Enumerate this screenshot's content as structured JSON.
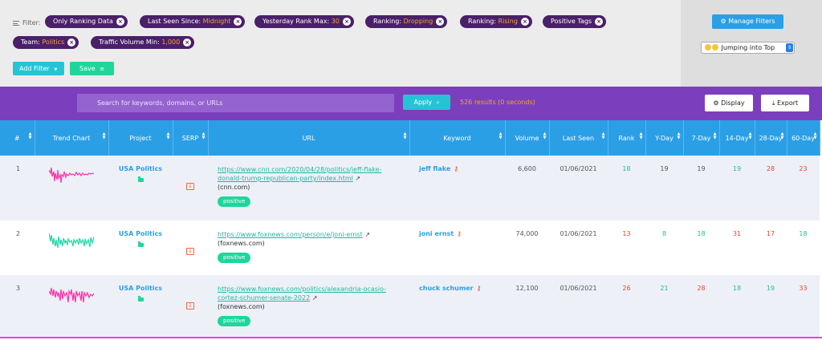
{
  "filters": {
    "label": "Filter:",
    "chips": [
      {
        "key": "Only Ranking Data",
        "value": ""
      },
      {
        "key": "Last Seen Since: ",
        "value": "Midnight"
      },
      {
        "key": "Yesterday Rank Max: ",
        "value": "30"
      },
      {
        "key": "Ranking: ",
        "value": "Dropping"
      },
      {
        "key": "Ranking: ",
        "value": "Rising"
      },
      {
        "key": "Positive Tags",
        "value": ""
      },
      {
        "key": "Team: ",
        "value": "Politics"
      },
      {
        "key": "Traffic Volume Min: ",
        "value": "1,000"
      }
    ],
    "add_filter_label": "Add Filter",
    "save_label": "Save",
    "manage_filters_label": "Manage Filters",
    "preset_selected": "Jumping into Top"
  },
  "search": {
    "placeholder": "Search for keywords, domains, or URLs",
    "apply_label": "Apply",
    "results_text": "526 results (0 seconds)",
    "display_label": "Display",
    "export_label": "Export"
  },
  "table": {
    "columns": [
      "#",
      "Trend Chart",
      "Project",
      "SERP",
      "URL",
      "Keyword",
      "Volume",
      "Last Seen",
      "Rank",
      "Y-Day",
      "7-Day",
      "14-Day",
      "28-Day",
      "60-Day"
    ],
    "rows": [
      {
        "index": "1",
        "project": "USA Politics",
        "url_line1": "https://www.cnn.com/2020/04/28/politics/jeff-flake-",
        "url_line2": "donald-trump-republican-party/index.html",
        "domain": "(cnn.com)",
        "tag": "positive",
        "keyword": "jeff flake",
        "volume": "6,600",
        "last_seen": "01/06/2021",
        "rank": "18",
        "yday": "19",
        "d7": "19",
        "d14": "19",
        "d28": "28",
        "d60": "23"
      },
      {
        "index": "2",
        "project": "USA Politics",
        "url_line1": "https://www.foxnews.com/person/e/joni-ernst",
        "url_line2": "",
        "domain": "(foxnews.com)",
        "tag": "positive",
        "keyword": "joni ernst",
        "volume": "74,000",
        "last_seen": "01/06/2021",
        "rank": "13",
        "yday": "8",
        "d7": "18",
        "d14": "31",
        "d28": "17",
        "d60": "18"
      },
      {
        "index": "3",
        "project": "USA Politics",
        "url_line1": "https://www.foxnews.com/politics/alexandria-ocasio-",
        "url_line2": "cortez-schumer-senate-2022",
        "domain": "(foxnews.com)",
        "tag": "positive",
        "keyword": "chuck schumer",
        "volume": "12,100",
        "last_seen": "01/06/2021",
        "rank": "26",
        "yday": "21",
        "d7": "28",
        "d14": "18",
        "d28": "19",
        "d60": "33"
      }
    ]
  },
  "icons": {
    "filter": "filter-lines-icon",
    "gear": "gear-icon",
    "search": "search-icon",
    "download": "download-icon",
    "key": "key-icon",
    "folder": "folder-icon",
    "external": "external-link-icon"
  },
  "colors": {
    "chip_bg": "#4a2069",
    "chip_value": "#f5a623",
    "accent_blue": "#2b9fe6",
    "purple_bar": "#7b3fbe",
    "teal": "#24c4d6",
    "green": "#1ed69c",
    "rank_up": "#1ec28b",
    "rank_down": "#ee4035",
    "spark_pink": "#ff2fa8",
    "spark_green": "#1ed6a4"
  }
}
